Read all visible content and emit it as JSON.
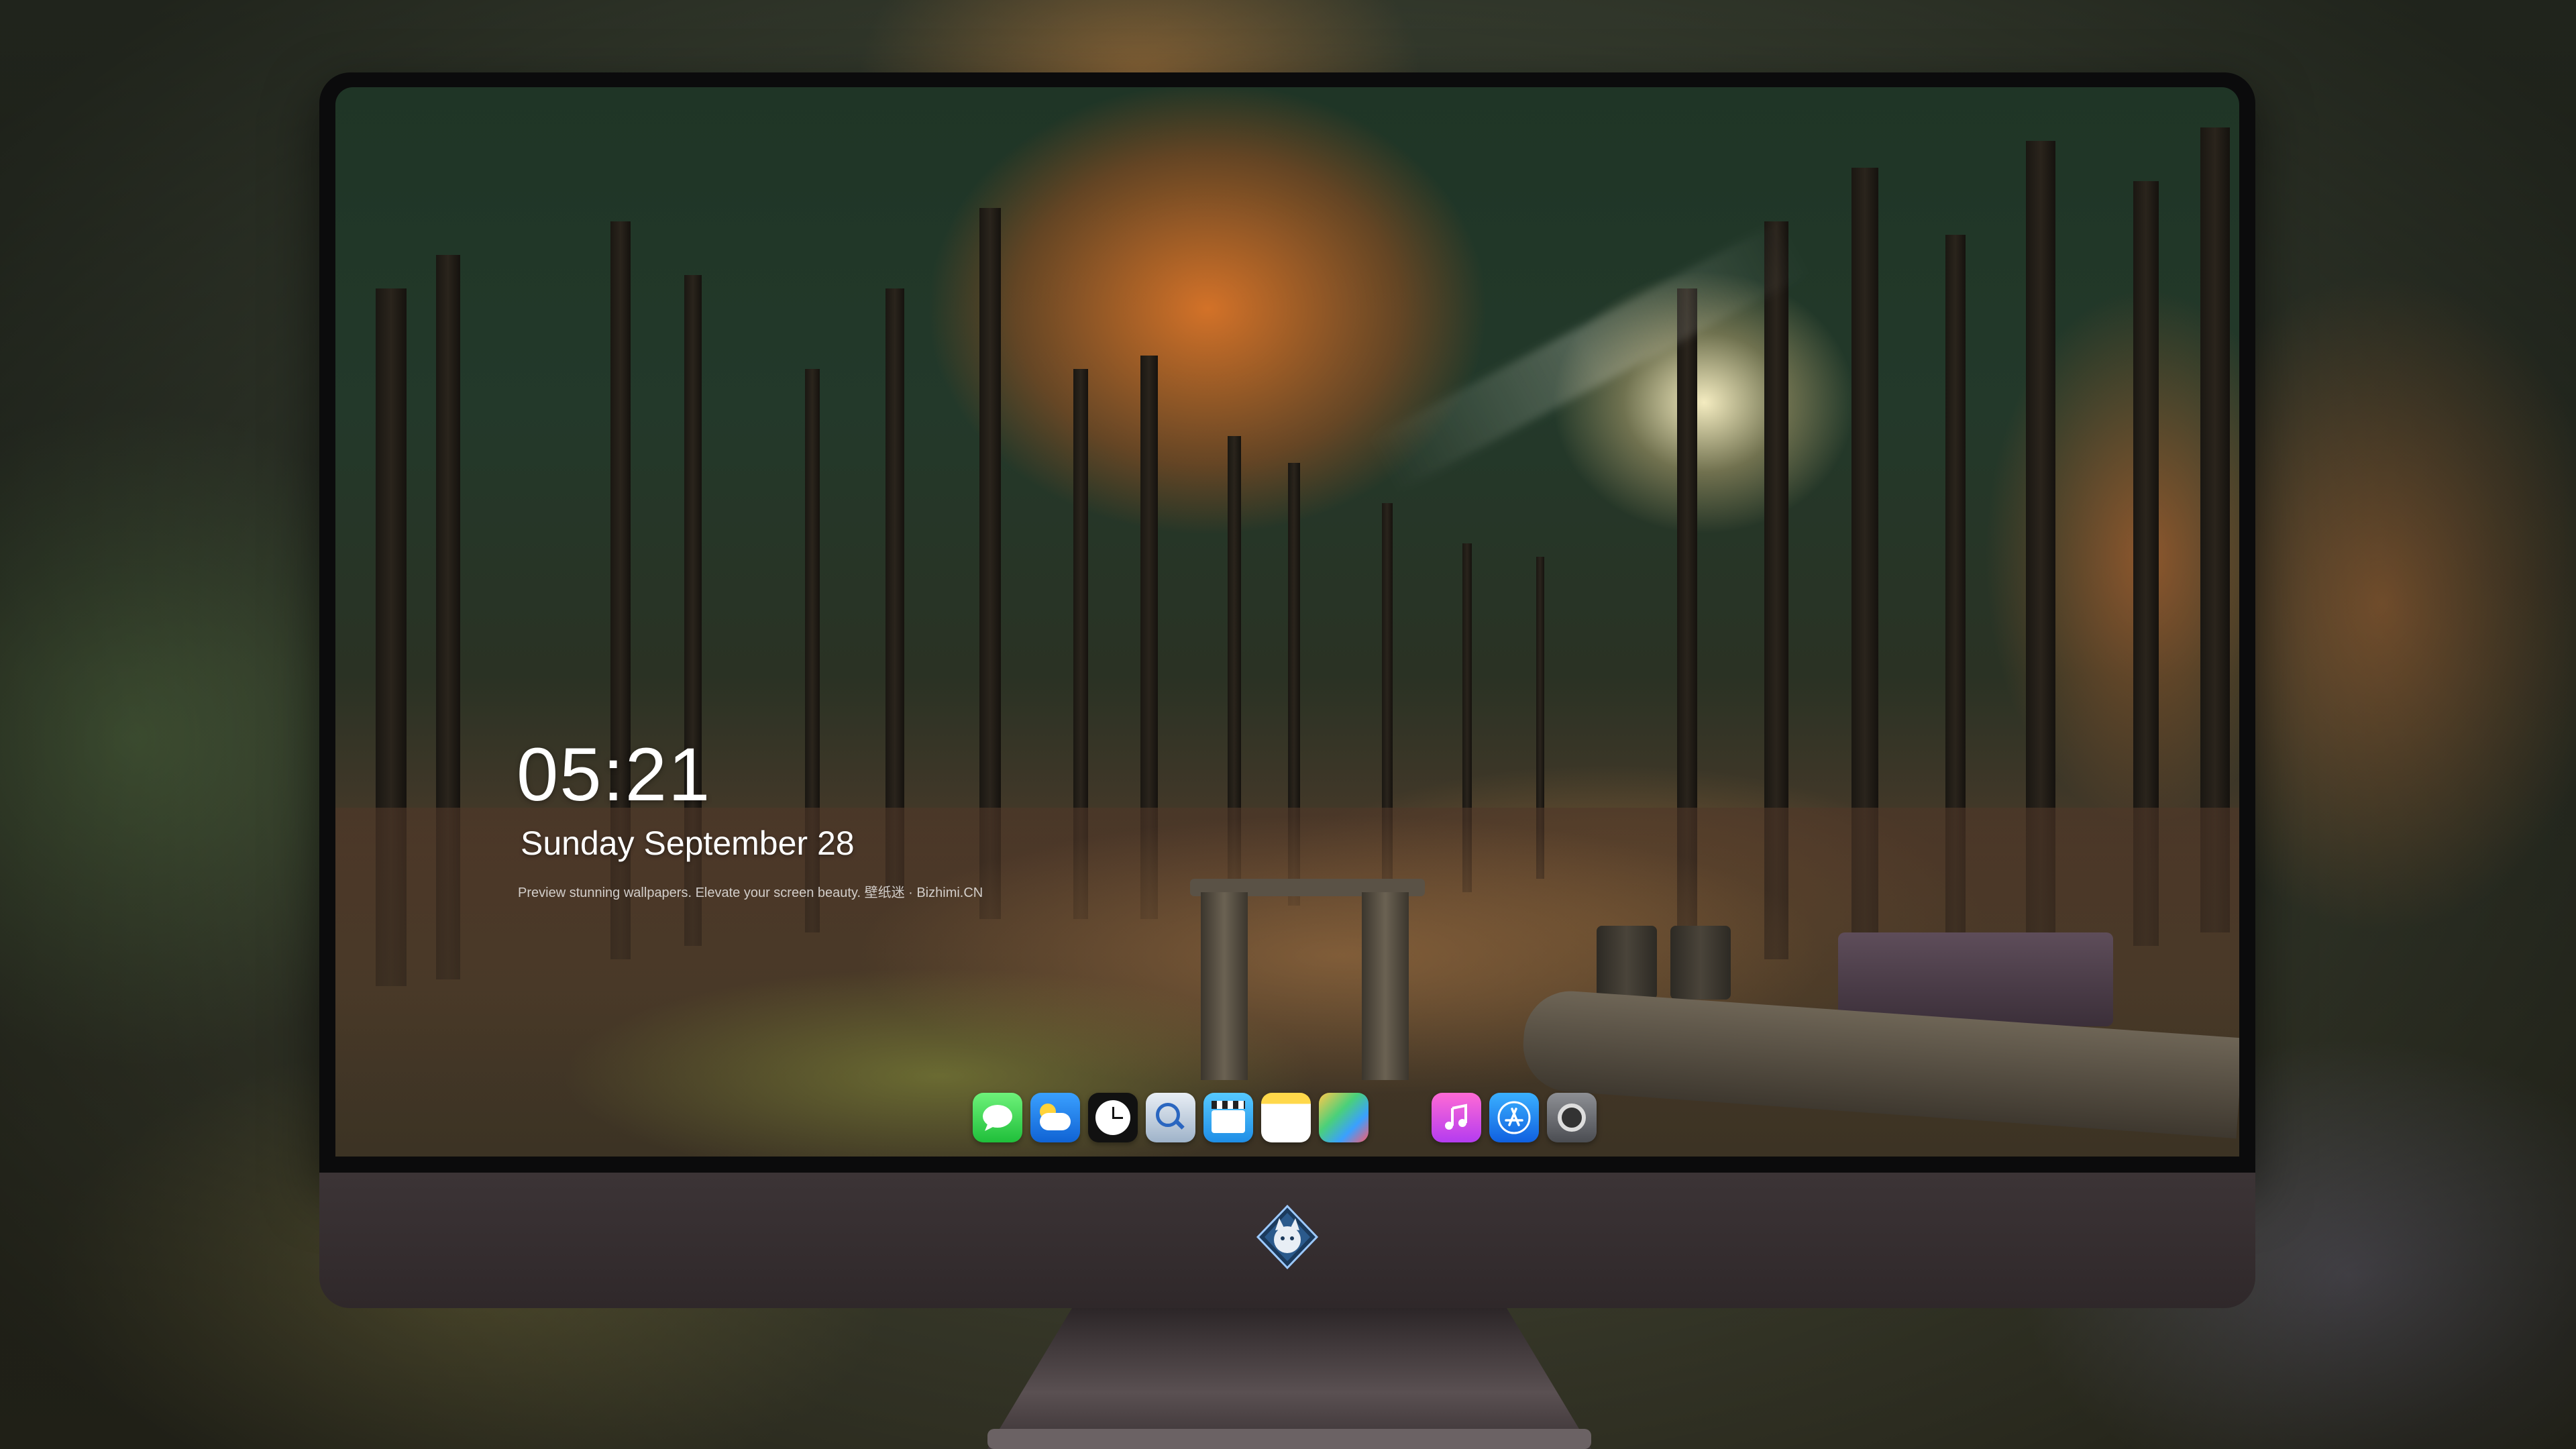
{
  "lockscreen": {
    "time": "05:21",
    "date": "Sunday September  28",
    "tagline": "Preview stunning wallpapers. Elevate your screen beauty. 壁纸迷 · Bizhimi.CN"
  },
  "dock": {
    "apps": [
      {
        "name": "Messages",
        "icon": "messages-icon"
      },
      {
        "name": "Weather",
        "icon": "weather-icon"
      },
      {
        "name": "Clock",
        "icon": "clock-icon"
      },
      {
        "name": "Preview",
        "icon": "preview-icon"
      },
      {
        "name": "Clips",
        "icon": "clips-icon"
      },
      {
        "name": "Notes",
        "icon": "notes-icon"
      },
      {
        "name": "Photos",
        "icon": "photos-icon"
      },
      {
        "name": "Music",
        "icon": "music-icon"
      },
      {
        "name": "App Store",
        "icon": "app-store-icon"
      },
      {
        "name": "Camera",
        "icon": "camera-icon"
      }
    ]
  },
  "monitor": {
    "logo": "kitsune-logo"
  },
  "colors": {
    "text": "#ffffff",
    "chin": "#3c3436",
    "bezel": "#0b0b0c"
  }
}
